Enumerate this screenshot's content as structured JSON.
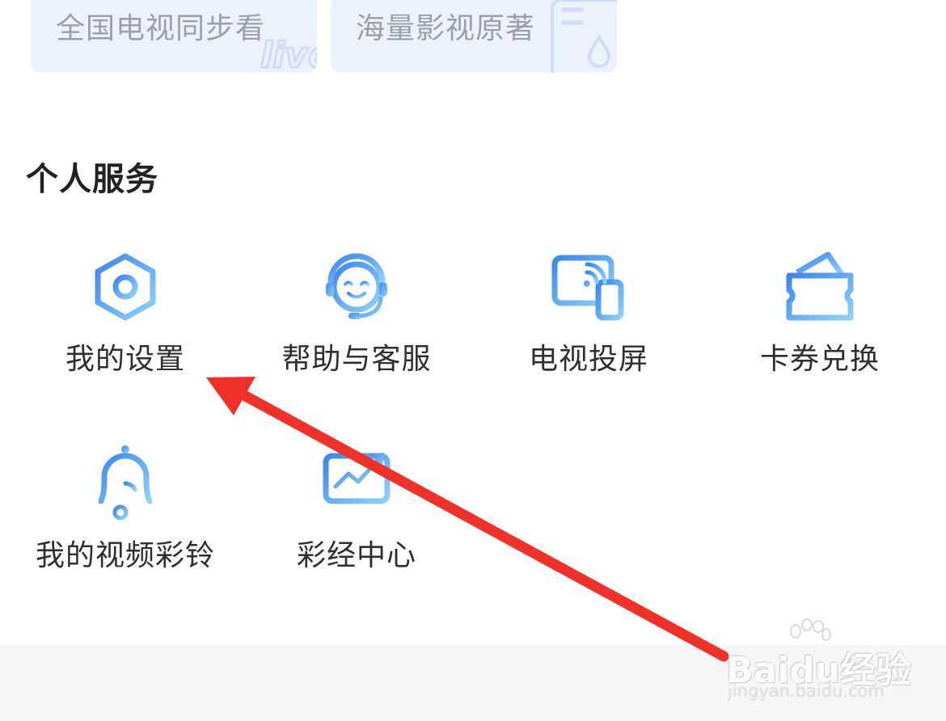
{
  "banners": [
    {
      "label": "全国电视同步看",
      "deco": "live"
    },
    {
      "label": "海量影视原著",
      "deco": "book-icon"
    }
  ],
  "section": {
    "title": "个人服务"
  },
  "services": [
    {
      "label": "我的设置",
      "icon": "settings-hexagon-icon"
    },
    {
      "label": "帮助与客服",
      "icon": "customer-service-headset-icon"
    },
    {
      "label": "电视投屏",
      "icon": "tv-cast-icon"
    },
    {
      "label": "卡券兑换",
      "icon": "voucher-ticket-icon"
    },
    {
      "label": "我的视频彩铃",
      "icon": "bell-music-icon"
    },
    {
      "label": "彩经中心",
      "icon": "stock-chart-icon"
    }
  ],
  "annotation": {
    "arrow_color": "#f0312a",
    "target": "我的设置"
  },
  "watermark": {
    "brand": "Baidu经验",
    "url": "jingyan.baidu.com"
  },
  "colors": {
    "icon_gradient_start": "#3f8ef0",
    "icon_gradient_end": "#8fd0f7",
    "banner_bg": "#ecf1fb"
  }
}
